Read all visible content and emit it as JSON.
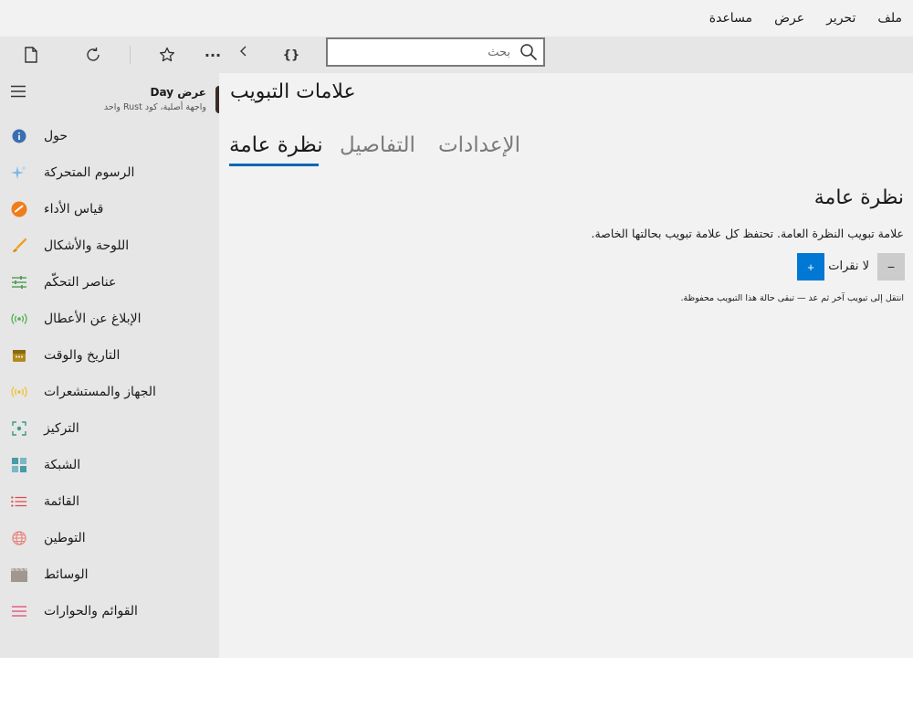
{
  "menu": [
    "ملف",
    "تحرير",
    "عرض",
    "مساعدة"
  ],
  "search": {
    "placeholder": "بحث"
  },
  "toolbar": {
    "icons": [
      "new-file-icon",
      "refresh-icon",
      "star-icon",
      "more-icon",
      "chevron-left-icon",
      "braces-icon",
      "search-icon"
    ],
    "more_label": "···",
    "braces_label": "{}"
  },
  "sidebar": {
    "title": "عرض Day",
    "subtitle": "واجهة أصلية، كود Rust واحد",
    "items": [
      {
        "label": "حول",
        "icon": "info-icon",
        "color": "#3b6db3"
      },
      {
        "label": "الرسوم المتحركة",
        "icon": "sparkle-icon",
        "color": "#7ab8e8"
      },
      {
        "label": "قياس الأداء",
        "icon": "gauge-icon",
        "color": "#f07d1b"
      },
      {
        "label": "اللوحة والأشكال",
        "icon": "brush-icon",
        "color": "#f0a020"
      },
      {
        "label": "عناصر التحكّم",
        "icon": "sliders-icon",
        "color": "#5aa05a"
      },
      {
        "label": "الإبلاغ عن الأعطال",
        "icon": "broadcast-icon",
        "color": "#4caf50"
      },
      {
        "label": "التاريخ والوقت",
        "icon": "calendar-icon",
        "color": "#b08a1e"
      },
      {
        "label": "الجهاز والمستشعرات",
        "icon": "sensor-icon",
        "color": "#f0c030"
      },
      {
        "label": "التركيز",
        "icon": "focus-icon",
        "color": "#3a9a8a"
      },
      {
        "label": "الشبكة",
        "icon": "grid-icon",
        "color": "#4a9aa8"
      },
      {
        "label": "القائمة",
        "icon": "list-icon",
        "color": "#e04a4a"
      },
      {
        "label": "التوطين",
        "icon": "globe-icon",
        "color": "#e8807a"
      },
      {
        "label": "الوسائط",
        "icon": "clapper-icon",
        "color": "#a09890"
      },
      {
        "label": "القوائم والحوارات",
        "icon": "menu-lines-icon",
        "color": "#e06080"
      }
    ]
  },
  "content": {
    "title": "علامات التبويب",
    "tabs": [
      "نظرة عامة",
      "التفاصيل",
      "الإعدادات"
    ],
    "active_tab": 0,
    "section_title": "نظرة عامة",
    "description": "علامة تبويب النظرة العامة. تحتفظ كل علامة تبويب بحالتها الخاصة.",
    "minus_label": "−",
    "counter_text": "لا نقرات",
    "plus_label": "+",
    "hint": "انتقل إلى تبويب آخر ثم عد — تبقى حالة هذا التبويب محفوظة.",
    "accent_color": "#0078d4"
  }
}
